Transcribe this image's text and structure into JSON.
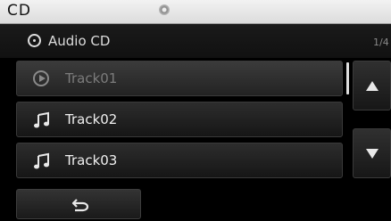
{
  "header": {
    "title": "CD"
  },
  "source": {
    "label": "Audio CD",
    "page": "1/4",
    "icon": "cd-icon"
  },
  "tracks": [
    {
      "name": "Track01",
      "icon": "play-circle-icon",
      "selected": true
    },
    {
      "name": "Track02",
      "icon": "music-note-icon",
      "selected": false
    },
    {
      "name": "Track03",
      "icon": "music-note-icon",
      "selected": false
    }
  ],
  "controls": {
    "scroll_up_icon": "up-arrow-icon",
    "scroll_down_icon": "down-arrow-icon",
    "back_icon": "back-arrow-icon"
  },
  "colors": {
    "header_bg": "#e6e6e6",
    "screen_bg": "#000000",
    "selected_text": "#7c7c7c",
    "text": "#f0f0f0"
  }
}
